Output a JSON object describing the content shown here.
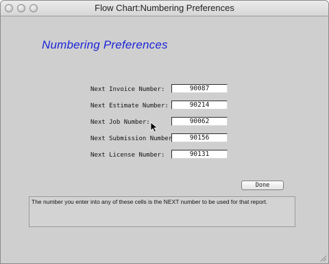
{
  "window": {
    "title": "Flow Chart:Numbering Preferences"
  },
  "main": {
    "heading": "Numbering Preferences",
    "fields": [
      {
        "label": "Next Invoice Number:",
        "value": "90087"
      },
      {
        "label": "Next Estimate Number:",
        "value": "90214"
      },
      {
        "label": "Next Job Number:",
        "value": "90062"
      },
      {
        "label": "Next Submission Number:",
        "value": "90156"
      },
      {
        "label": "Next License Number:",
        "value": "90131"
      }
    ],
    "done_label": "Done",
    "note": "The number you enter into any of these cells is the NEXT number to be used for that report."
  },
  "colors": {
    "heading": "#1b24d8",
    "background": "#cfcfcf"
  },
  "icons": {
    "cursor": "arrow-cursor-icon",
    "resize": "resize-grip-icon"
  }
}
